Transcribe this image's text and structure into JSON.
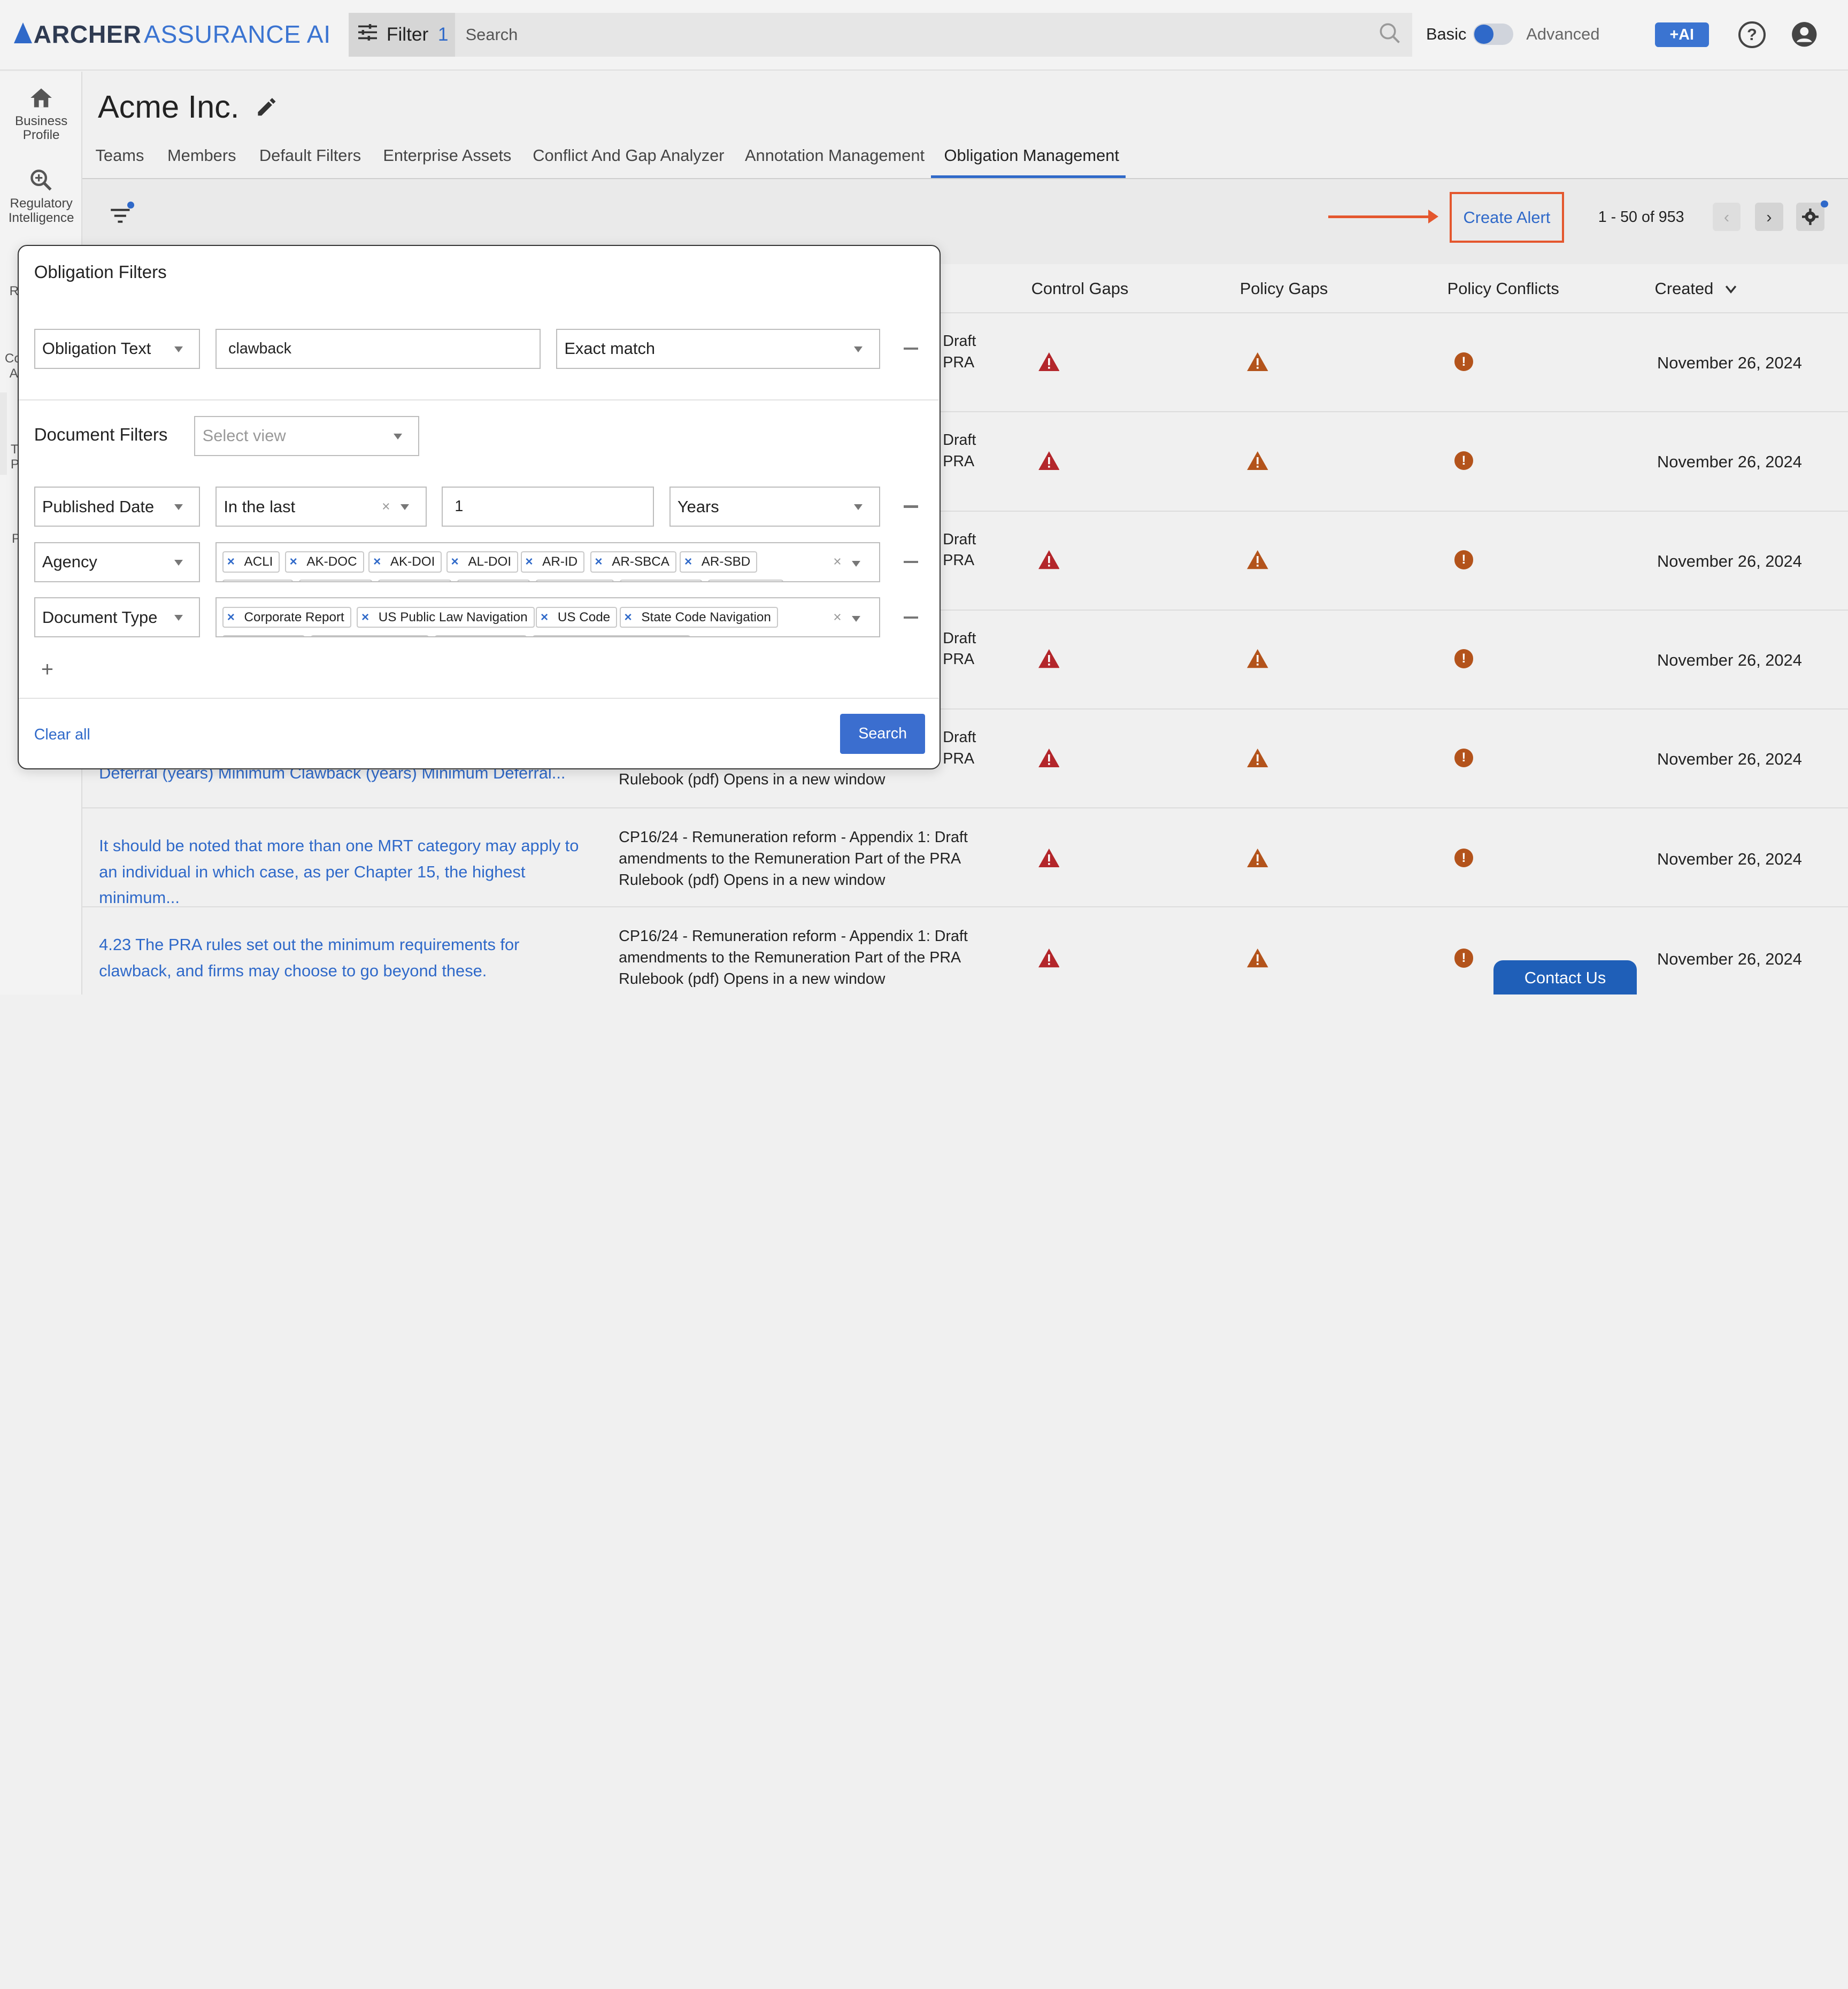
{
  "app": {
    "logo_bold": "ARCHER",
    "logo_light": "ASSURANCE AI",
    "filter_label": "Filter",
    "filter_count": "1",
    "search_placeholder": "Search",
    "mode_basic": "Basic",
    "mode_advanced": "Advanced",
    "ai_label": "+AI",
    "help_symbol": "?"
  },
  "rail": {
    "items": [
      {
        "label": "Business Profile",
        "icon": "house-icon"
      },
      {
        "label": "Regulatory Intelligence",
        "icon": "magnify-icon"
      }
    ],
    "fragments": [
      "R",
      "Co",
      "A",
      "T",
      "P",
      "P"
    ]
  },
  "page": {
    "company": "Acme Inc.",
    "tabs": [
      "Teams",
      "Members",
      "Default Filters",
      "Enterprise Assets",
      "Conflict And Gap Analyzer",
      "Annotation Management",
      "Obligation Management"
    ],
    "active_tab": "Obligation Management"
  },
  "toolbar": {
    "create_alert": "Create Alert",
    "pager": "1 - 50 of 953",
    "prev": "‹",
    "next": "›"
  },
  "table": {
    "columns": {
      "control_gaps": "Control Gaps",
      "policy_gaps": "Policy Gaps",
      "policy_conflicts": "Policy Conflicts",
      "created": "Created"
    },
    "rows": [
      {
        "obligation": "",
        "doc_frag1": "Draft",
        "doc_frag2": "PRA",
        "date": "November 26, 2024"
      },
      {
        "obligation": "",
        "doc_frag1": "Draft",
        "doc_frag2": "PRA",
        "date": "November 26, 2024"
      },
      {
        "obligation": "",
        "doc_frag1": "Draft",
        "doc_frag2": "PRA",
        "date": "November 26, 2024"
      },
      {
        "obligation": "",
        "doc_frag1": "Draft",
        "doc_frag2": "PRA",
        "date": "November 26, 2024"
      },
      {
        "obligation": "Deferral (years) Minimum Clawback (years) Minimum Deferral...",
        "doc_frag1": "Draft",
        "doc_frag2": "PRA",
        "doc_line3": "Rulebook (pdf) Opens in a new window",
        "date": "November 26, 2024"
      },
      {
        "obligation": "It should be noted that more than one MRT category may apply to an individual in which case, as per Chapter 15, the highest minimum...",
        "doc": "CP16/24 - Remuneration reform - Appendix 1: Draft amendments to the Remuneration Part of the PRA Rulebook (pdf) Opens in a new window",
        "date": "November 26, 2024"
      },
      {
        "obligation": "4.23 The PRA rules set out the minimum requirements for clawback, and firms may choose to go beyond these.",
        "doc": "CP16/24 - Remuneration reform - Appendix 1: Draft amendments to the Remuneration Part of the PRA Rulebook (pdf) Opens in a new window",
        "date": "November 26, 2024"
      }
    ]
  },
  "contact": "Contact Us",
  "filters": {
    "title": "Obligation Filters",
    "obligation_field": "Obligation Text",
    "obligation_value": "clawback",
    "match_type": "Exact match",
    "doc_section": "Document Filters",
    "view_placeholder": "Select view",
    "date_field": "Published Date",
    "date_op": "In the last",
    "date_value": "1",
    "date_unit": "Years",
    "agency_field": "Agency",
    "agency_chips": [
      "ACLI",
      "AK-DOC",
      "AK-DOI",
      "AL-DOI",
      "AR-ID",
      "AR-SBCA",
      "AR-SBD"
    ],
    "doctype_field": "Document Type",
    "doctype_chips": [
      "Corporate Report",
      "US Public Law Navigation",
      "US Code",
      "State Code Navigation"
    ],
    "clear_all": "Clear all",
    "search": "Search"
  },
  "colors": {
    "accent": "#2f69c9",
    "warning": "#b3531b",
    "danger": "#b3262b",
    "highlight": "#e4572e"
  }
}
